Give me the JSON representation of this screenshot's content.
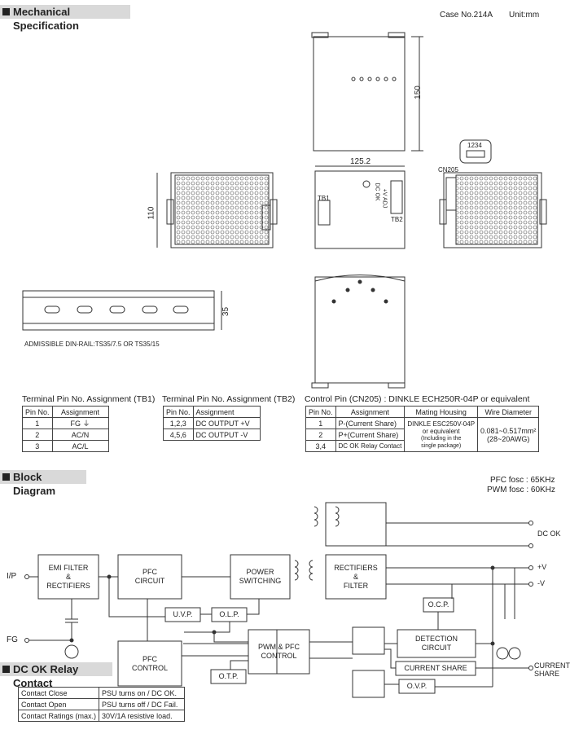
{
  "mech": {
    "title": "Mechanical Specification",
    "case": "Case No.214A",
    "unit": "Unit:mm",
    "dims": {
      "height": "150",
      "depth": "110",
      "width": "125.2",
      "rail": "35"
    },
    "labels": {
      "tb1": "TB1",
      "tb2": "TB2",
      "cn205": "CN205",
      "cn_pins": "1234",
      "dcok": "DC OK",
      "vadj": "+V ADJ"
    },
    "rail_note": "ADMISSIBLE DIN-RAIL:TS35/7.5 OR TS35/15"
  },
  "tb1": {
    "title": "Terminal Pin No.  Assignment (TB1)",
    "headers": [
      "Pin No.",
      "Assignment"
    ],
    "rows": [
      [
        "1",
        "FG ⏚"
      ],
      [
        "2",
        "AC/N"
      ],
      [
        "3",
        "AC/L"
      ]
    ]
  },
  "tb2": {
    "title": "Terminal Pin No.  Assignment (TB2)",
    "headers": [
      "Pin No.",
      "Assignment"
    ],
    "rows": [
      [
        "1,2,3",
        "DC OUTPUT +V"
      ],
      [
        "4,5,6",
        "DC OUTPUT -V"
      ]
    ]
  },
  "cn205": {
    "title": "Control Pin (CN205) : DINKLE  ECH250R-04P or equivalent",
    "headers": [
      "Pin No.",
      "Assignment",
      "Mating Housing",
      "Wire Diameter"
    ],
    "rows": [
      [
        "1",
        "P-(Current Share)"
      ],
      [
        "2",
        "P+(Current Share)"
      ],
      [
        "3,4",
        "DC OK Relay Contact"
      ]
    ],
    "housing": [
      "DINKLE ESC250V-04P",
      "or equivalent",
      "(Including in the",
      "single package)"
    ],
    "wire": [
      "0.081~0.517mm²",
      "(28~20AWG)"
    ]
  },
  "block": {
    "title": "Block Diagram",
    "pfc_fosc": "PFC fosc : 65KHz",
    "pwm_fosc": "PWM fosc : 60KHz",
    "ip": "I/P",
    "fg": "FG",
    "emi": [
      "EMI FILTER",
      "&",
      "RECTIFIERS"
    ],
    "pfc_circuit": [
      "PFC",
      "CIRCUIT"
    ],
    "power_sw": [
      "POWER",
      "SWITCHING"
    ],
    "rect": [
      "RECTIFIERS",
      "&",
      "FILTER"
    ],
    "uvp": "U.V.P.",
    "olp": "O.L.P.",
    "pwm": [
      "PWM & PFC",
      "CONTROL"
    ],
    "pfc_control": [
      "PFC",
      "CONTROL"
    ],
    "otp": "O.T.P.",
    "ocp": "O.C.P.",
    "detection": [
      "DETECTION",
      "CIRCUIT"
    ],
    "cs": "CURRENT SHARE",
    "ovp": "O.V.P.",
    "dcok": "DC OK",
    "vp": "+V",
    "vn": "-V",
    "cs_out": [
      "CURRENT",
      "SHARE"
    ]
  },
  "relay": {
    "title": "DC OK Relay Contact",
    "rows": [
      [
        "Contact Close",
        "PSU turns on / DC OK."
      ],
      [
        "Contact Open",
        "PSU turns off / DC Fail."
      ],
      [
        "Contact Ratings (max.)",
        "30V/1A resistive load."
      ]
    ]
  }
}
